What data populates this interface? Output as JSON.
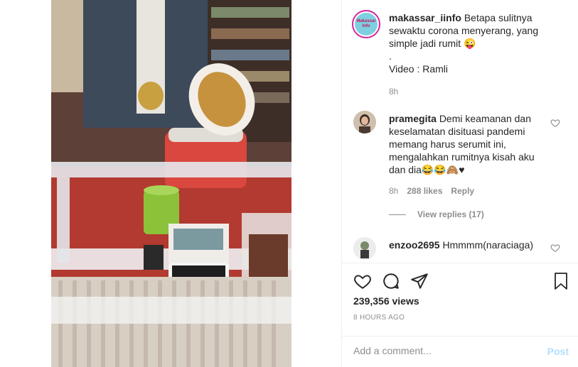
{
  "post": {
    "author": "makassar_iinfo",
    "avatar_text": "Makassar Info",
    "caption_text": "Betapa sulitnya sewaktu corona menyerang, yang simple jadi rumit 😜",
    "caption_dot": ".",
    "caption_credit": "Video : Ramli",
    "time": "8h"
  },
  "comments": [
    {
      "username": "pramegita",
      "text": "Demi keamanan dan keselamatan disituasi pandemi memang harus serumit ini, mengalahkan rumitnya kisah aku dan dia😂😂🙈♥",
      "time": "8h",
      "likes": "288 likes",
      "reply_label": "Reply",
      "view_replies": "View replies (17)"
    },
    {
      "username": "enzoo2695",
      "text": "Hmmmm(naraciaga)"
    }
  ],
  "stats": {
    "views": "239,356 views",
    "posted": "8 HOURS AGO"
  },
  "comment_form": {
    "placeholder": "Add a comment...",
    "post_label": "Post"
  },
  "icons": {
    "like": "heart-icon",
    "comment": "comment-bubble-icon",
    "share": "paper-plane-icon",
    "save": "bookmark-icon"
  },
  "colors": {
    "post_button": "#b2dffc",
    "secondary_text": "#8e8e8e"
  }
}
